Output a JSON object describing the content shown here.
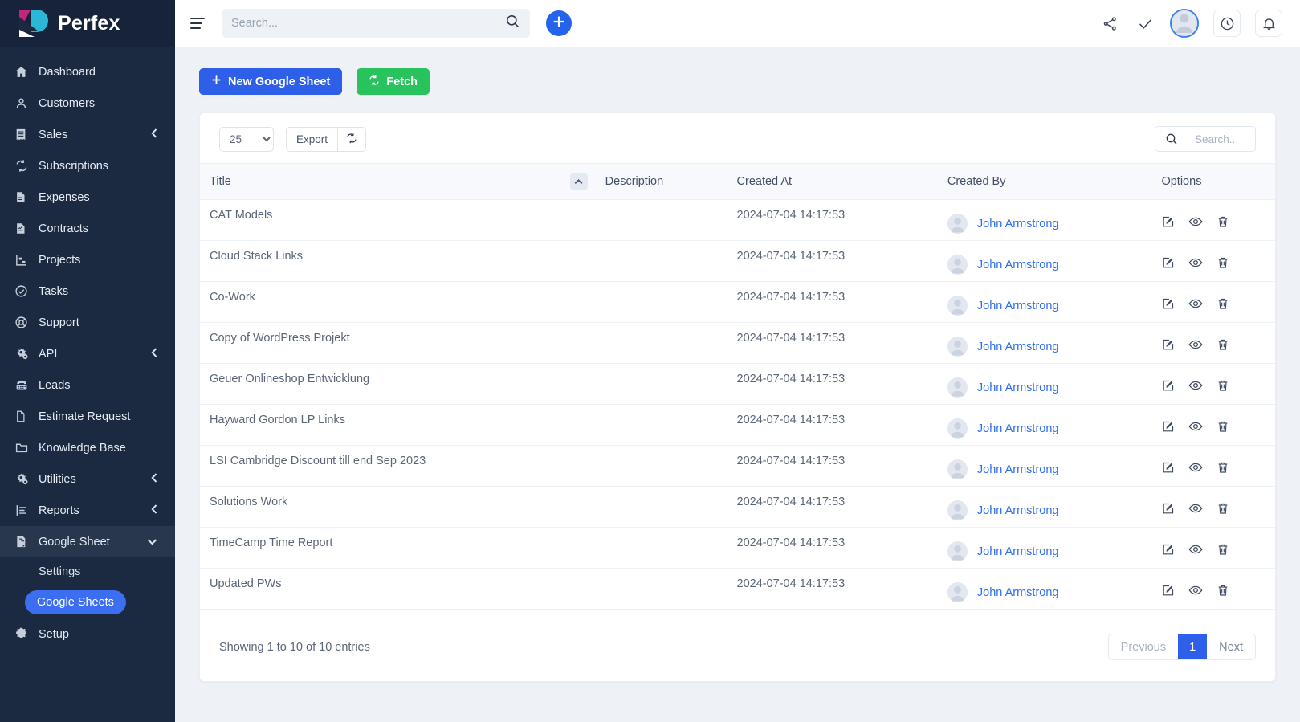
{
  "brand": {
    "name": "Perfex",
    "logo_icon": "perfex-logo-icon"
  },
  "sidebar": {
    "items": [
      {
        "label": "Dashboard",
        "icon": "home-icon",
        "caret": null,
        "active": false
      },
      {
        "label": "Customers",
        "icon": "user-icon",
        "caret": null,
        "active": false
      },
      {
        "label": "Sales",
        "icon": "receipt-icon",
        "caret": "chevron-left-icon",
        "active": false
      },
      {
        "label": "Subscriptions",
        "icon": "refresh-cycle-icon",
        "caret": null,
        "active": false
      },
      {
        "label": "Expenses",
        "icon": "file-lines-icon",
        "caret": null,
        "active": false
      },
      {
        "label": "Contracts",
        "icon": "file-signature-icon",
        "caret": null,
        "active": false
      },
      {
        "label": "Projects",
        "icon": "chart-project-icon",
        "caret": null,
        "active": false
      },
      {
        "label": "Tasks",
        "icon": "check-circle-icon",
        "caret": null,
        "active": false
      },
      {
        "label": "Support",
        "icon": "lifebuoy-icon",
        "caret": null,
        "active": false
      },
      {
        "label": "API",
        "icon": "gears-icon",
        "caret": "chevron-left-icon",
        "active": false
      },
      {
        "label": "Leads",
        "icon": "telephone-icon",
        "caret": null,
        "active": false
      },
      {
        "label": "Estimate Request",
        "icon": "file-icon",
        "caret": null,
        "active": false
      },
      {
        "label": "Knowledge Base",
        "icon": "folder-icon",
        "caret": null,
        "active": false
      },
      {
        "label": "Utilities",
        "icon": "gears-icon",
        "caret": "chevron-left-icon",
        "active": false
      },
      {
        "label": "Reports",
        "icon": "bar-list-icon",
        "caret": "chevron-left-icon",
        "active": false
      },
      {
        "label": "Google Sheet",
        "icon": "sheet-icon",
        "caret": "chevron-down-icon",
        "active": true
      }
    ],
    "submenu": [
      {
        "label": "Settings",
        "kind": "link"
      },
      {
        "label": "Google Sheets",
        "kind": "chip"
      }
    ],
    "footer_item": {
      "label": "Setup",
      "icon": "gear-icon"
    }
  },
  "topbar": {
    "menu_icon": "hamburger-icon",
    "search": {
      "value": "",
      "placeholder": "Search...",
      "icon": "search-icon"
    },
    "add_icon": "plus-icon",
    "share_icon": "share-icon",
    "check_icon": "check-icon",
    "avatar_icon": "avatar-icon",
    "clock_icon": "clock-icon",
    "bell_icon": "bell-icon"
  },
  "toolbar": {
    "new_sheet_label": "New Google Sheet",
    "new_sheet_icon": "plus-icon",
    "fetch_label": "Fetch",
    "fetch_icon": "refresh-icon"
  },
  "table_controls": {
    "page_length": "25",
    "page_length_options": [
      "25"
    ],
    "export_label": "Export",
    "reload_icon": "refresh-icon",
    "search": {
      "value": "",
      "placeholder": "Search..",
      "icon": "search-icon"
    }
  },
  "table": {
    "columns": [
      "Title",
      "Description",
      "Created At",
      "Created By",
      "Options"
    ],
    "sort": {
      "column": "Title",
      "direction": "asc",
      "icon": "chevron-up-icon"
    },
    "row_icons": [
      "edit-icon",
      "view-icon",
      "delete-icon"
    ],
    "rows": [
      {
        "title": "CAT Models",
        "description": "",
        "created_at": "2024-07-04 14:17:53",
        "created_by": "John Armstrong"
      },
      {
        "title": "Cloud Stack Links",
        "description": "",
        "created_at": "2024-07-04 14:17:53",
        "created_by": "John Armstrong"
      },
      {
        "title": "Co-Work",
        "description": "",
        "created_at": "2024-07-04 14:17:53",
        "created_by": "John Armstrong"
      },
      {
        "title": "Copy of WordPress Projekt",
        "description": "",
        "created_at": "2024-07-04 14:17:53",
        "created_by": "John Armstrong"
      },
      {
        "title": "Geuer Onlineshop Entwicklung",
        "description": "",
        "created_at": "2024-07-04 14:17:53",
        "created_by": "John Armstrong"
      },
      {
        "title": "Hayward Gordon LP Links",
        "description": "",
        "created_at": "2024-07-04 14:17:53",
        "created_by": "John Armstrong"
      },
      {
        "title": "LSI Cambridge Discount till end Sep 2023",
        "description": "",
        "created_at": "2024-07-04 14:17:53",
        "created_by": "John Armstrong"
      },
      {
        "title": "Solutions Work",
        "description": "",
        "created_at": "2024-07-04 14:17:53",
        "created_by": "John Armstrong"
      },
      {
        "title": "TimeCamp Time Report",
        "description": "",
        "created_at": "2024-07-04 14:17:53",
        "created_by": "John Armstrong"
      },
      {
        "title": "Updated PWs",
        "description": "",
        "created_at": "2024-07-04 14:17:53",
        "created_by": "John Armstrong"
      }
    ]
  },
  "footer": {
    "showing": "Showing 1 to 10 of 10 entries",
    "pagination": {
      "previous": "Previous",
      "current": "1",
      "next": "Next"
    }
  },
  "colors": {
    "sidebar_bg": "#1b2a41",
    "brand_blue": "#2e5fe8",
    "success_green": "#29c35e",
    "link_blue": "#2f6ef0",
    "page_bg": "#eef1f6"
  }
}
